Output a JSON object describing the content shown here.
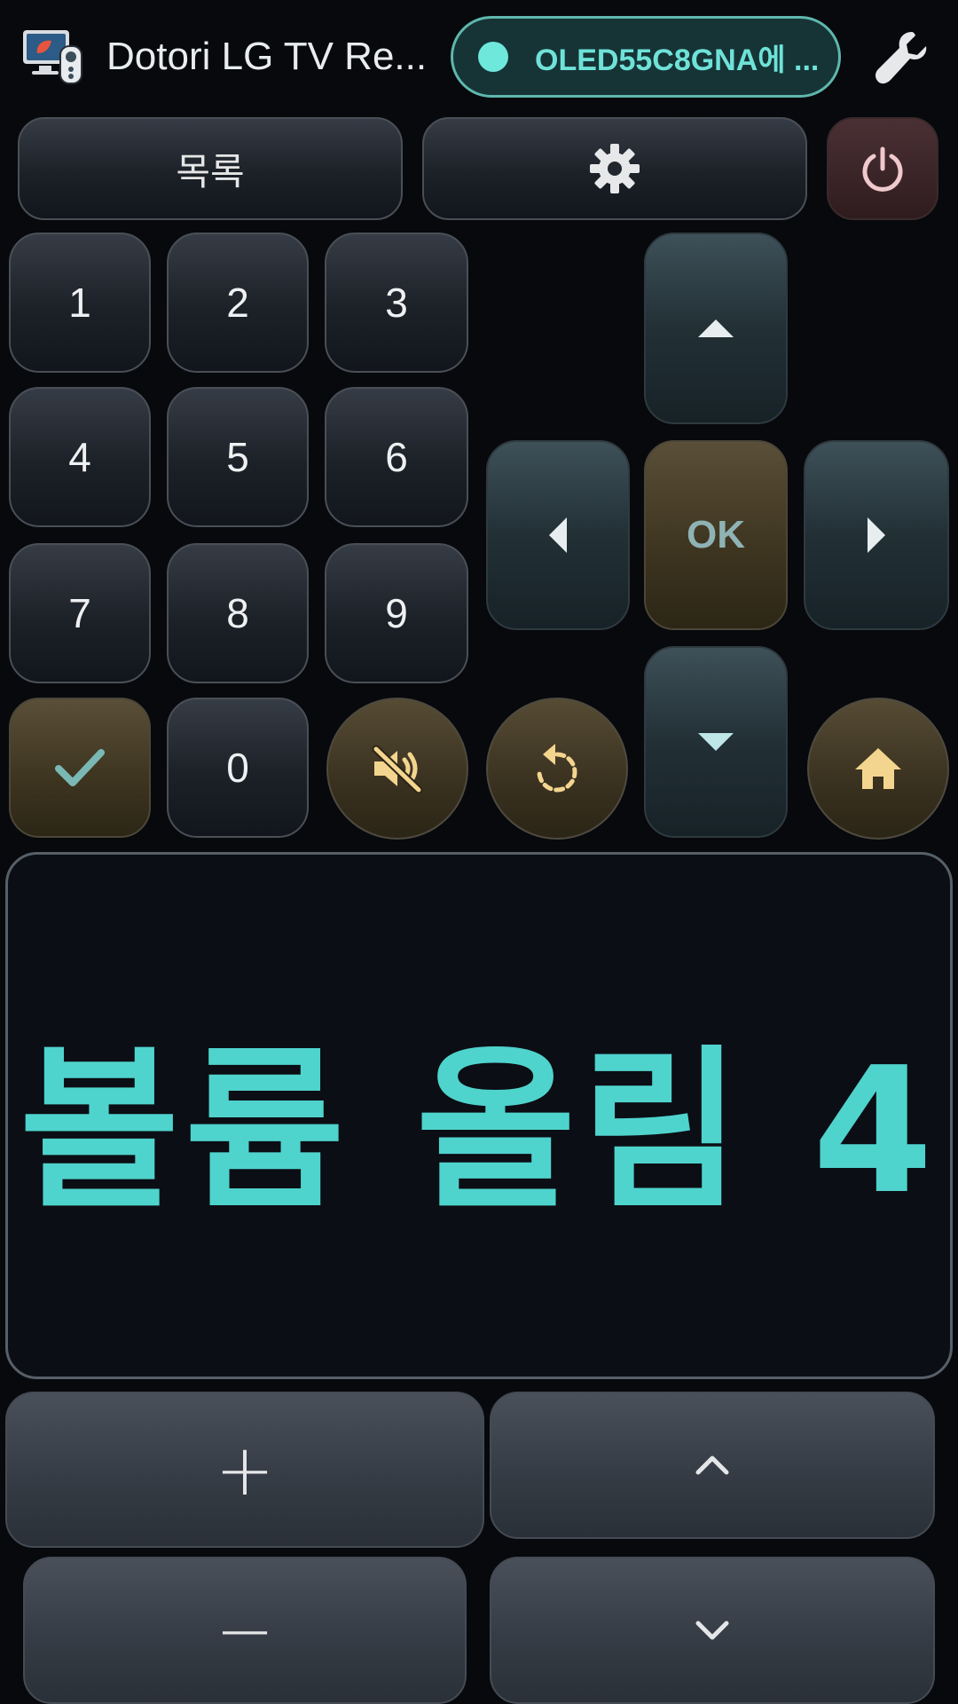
{
  "header": {
    "title": "Dotori LG TV Re...",
    "connection_label": "OLED55C8GNA에 ...",
    "connection_color": "#6fe8dc"
  },
  "toolbar": {
    "list_label": "목록",
    "settings_icon": "gear-icon",
    "power_icon": "power-icon"
  },
  "keypad": {
    "keys": [
      "1",
      "2",
      "3",
      "4",
      "5",
      "6",
      "7",
      "8",
      "9",
      "0"
    ]
  },
  "dpad": {
    "ok_label": "OK"
  },
  "display": {
    "text": "볼륨 올림 4",
    "color": "#4fd3cd"
  },
  "volume": {
    "plus_label": "+",
    "minus_label": "−"
  },
  "icons": [
    "app-icon",
    "wrench-icon",
    "gear-icon",
    "power-icon",
    "check-icon",
    "mute-icon",
    "replay-icon",
    "home-icon",
    "arrow-up-icon",
    "arrow-down-icon",
    "arrow-left-icon",
    "arrow-right-icon",
    "chevron-up-icon",
    "chevron-down-icon"
  ]
}
